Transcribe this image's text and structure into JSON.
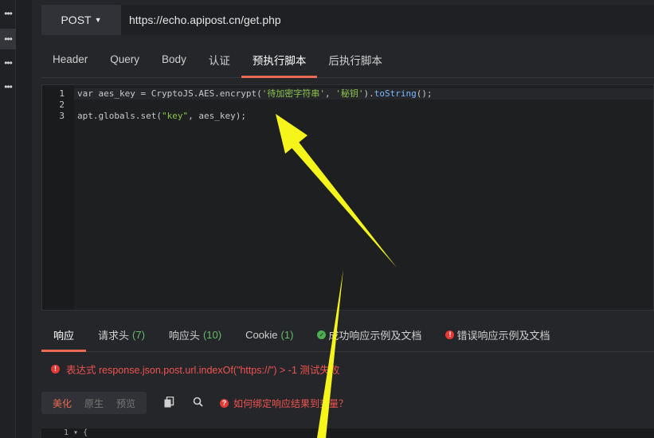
{
  "sidebar": {
    "items": [
      {
        "icon": "ellipsis-icon",
        "glyph": "•••"
      },
      {
        "icon": "ellipsis-icon",
        "glyph": "•••"
      },
      {
        "icon": "ellipsis-icon",
        "glyph": "•••"
      },
      {
        "icon": "ellipsis-icon",
        "glyph": "•••"
      }
    ]
  },
  "request": {
    "method": "POST",
    "url": "https://echo.apipost.cn/get.php"
  },
  "req_tabs": [
    {
      "label": "Header"
    },
    {
      "label": "Query"
    },
    {
      "label": "Body"
    },
    {
      "label": "认证"
    },
    {
      "label": "预执行脚本"
    },
    {
      "label": "后执行脚本"
    }
  ],
  "editor": {
    "line_numbers": [
      "1",
      "2",
      "3"
    ],
    "lines": {
      "l1_var": "var aes_key = CryptoJS.AES.encrypt(",
      "l1_str1": "'待加密字符串'",
      "l1_sep": ", ",
      "l1_str2": "'秘钥'",
      "l1_close": ").",
      "l1_fn": "toString",
      "l1_end": "();",
      "l3_start": "apt.globals.set(",
      "l3_str": "\"key\"",
      "l3_end": ", aes_key);"
    }
  },
  "resp_tabs": {
    "response": "响应",
    "req_headers": "请求头",
    "req_headers_count": "(7)",
    "resp_headers": "响应头",
    "resp_headers_count": "(10)",
    "cookie": "Cookie",
    "cookie_count": "(1)",
    "success_docs": "成功响应示例及文档",
    "error_docs": "错误响应示例及文档"
  },
  "error_message": "表达式 response.json.post.url.indexOf(\"https://\") > -1 测试失败",
  "toolbar": {
    "beautify": "美化",
    "raw": "原生",
    "preview": "预览",
    "help": "如何绑定响应结果到变量？"
  },
  "response_editor": {
    "first_line": "1 ▾ {"
  },
  "colors": {
    "accent": "#e96a52",
    "success": "#4caf50",
    "error": "#ef5350",
    "annotation_arrow": "#f5f51c"
  }
}
